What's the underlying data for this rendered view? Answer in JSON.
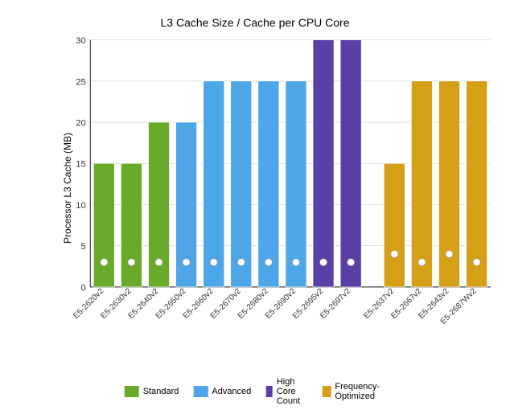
{
  "title": "L3 Cache Size / Cache per CPU Core",
  "yAxisLabel": "Processor L3 Cache (MB)",
  "colors": {
    "standard": "#6aaa2a",
    "advanced": "#4da6e8",
    "highCore": "#5b3ea6",
    "freqOpt": "#d4a017"
  },
  "legend": [
    {
      "label": "Standard",
      "color": "#6aaa2a"
    },
    {
      "label": "Advanced",
      "color": "#4da6e8"
    },
    {
      "label": "High Core Count",
      "color": "#5b3ea6"
    },
    {
      "label": "Frequency-Optimized",
      "color": "#d4a017"
    }
  ],
  "bars": [
    {
      "label": "E5-2620v2",
      "value": 15,
      "category": "standard"
    },
    {
      "label": "E5-2630v2",
      "value": 15,
      "category": "standard"
    },
    {
      "label": "E5-2640v2",
      "value": 20,
      "category": "standard"
    },
    {
      "label": "E5-2650v2",
      "value": 20,
      "category": "advanced"
    },
    {
      "label": "E5-2660v2",
      "value": 25,
      "category": "advanced"
    },
    {
      "label": "E5-2670v2",
      "value": 25,
      "category": "advanced"
    },
    {
      "label": "E5-2680v2",
      "value": 25,
      "category": "advanced"
    },
    {
      "label": "E5-2690v2",
      "value": 25,
      "category": "advanced"
    },
    {
      "label": "E5-2695v2",
      "value": 30,
      "category": "highCore"
    },
    {
      "label": "E5-2697v2",
      "value": 30,
      "category": "highCore"
    },
    {
      "label": "E5-2637v2",
      "value": 15,
      "category": "freqOpt"
    },
    {
      "label": "E5-2667v2",
      "value": 25,
      "category": "freqOpt"
    },
    {
      "label": "E5-2643v2",
      "value": 25,
      "category": "freqOpt"
    },
    {
      "label": "E5-2687Wv2",
      "value": 25,
      "category": "freqOpt"
    }
  ],
  "dotValues": [
    3,
    3,
    3,
    3,
    3,
    3,
    3,
    3,
    3,
    3,
    4,
    3,
    4,
    3
  ],
  "yTicks": [
    0,
    5,
    10,
    15,
    20,
    25,
    30
  ],
  "yMax": 30
}
